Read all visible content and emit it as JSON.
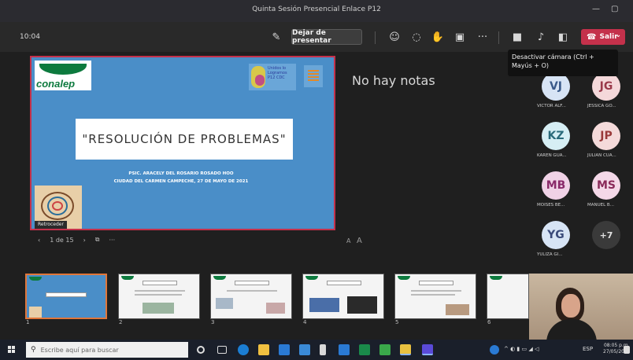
{
  "window": {
    "title": "Quinta Sesión Presencial Enlace P12",
    "minimize": "—",
    "maximize": "▢"
  },
  "meeting": {
    "timer": "10:04",
    "stop_presenting": "Dejar de presentar",
    "leave": "Salir",
    "tooltip": "Desactivar cámara (Ctrl + Mayús + O)"
  },
  "slide": {
    "logo_text": "conalep",
    "partner_logo_text": "Unidos lo Logramos P12 CDC",
    "title": "\"RESOLUCIÓN DE PROBLEMAS\"",
    "author_line1": "PSIC. ARACELY DEL ROSARIO ROSADO HOO",
    "author_line2": "CIUDAD DEL CARMEN CAMPECHE, 27 DE MAYO DE 2021",
    "presenting_tag": "Retroceder"
  },
  "slide_nav": {
    "page": "1 de 15",
    "next": "›",
    "prev": "‹",
    "more": "···",
    "font_small": "A",
    "font_large": "A"
  },
  "notes": {
    "text": "No hay notas"
  },
  "participants": [
    {
      "initials": "VJ",
      "name": "VICTOR ALF...",
      "bg": "#d7e4f5",
      "fg": "#3a5a8a"
    },
    {
      "initials": "JG",
      "name": "JESSICA GO...",
      "bg": "#f4d8da",
      "fg": "#9a3a4a"
    },
    {
      "initials": "KZ",
      "name": "KAREN GUA...",
      "bg": "#d6eef4",
      "fg": "#2a6a7a"
    },
    {
      "initials": "JP",
      "name": "JULIAN CUA...",
      "bg": "#f4dada",
      "fg": "#9a3a3a"
    },
    {
      "initials": "MB",
      "name": "MOISES BE...",
      "bg": "#f0d2e6",
      "fg": "#8a2a6a"
    },
    {
      "initials": "MS",
      "name": "MANUEL B...",
      "bg": "#f4d8e8",
      "fg": "#8a2a5a"
    },
    {
      "initials": "YG",
      "name": "YULIZA GI...",
      "bg": "#d7e4f5",
      "fg": "#3a4a7a"
    },
    {
      "initials": "+7",
      "name": "",
      "bg": "#3a3a3a",
      "fg": "#e0e0e0"
    }
  ],
  "thumbnails": [
    "1",
    "2",
    "3",
    "4",
    "5",
    "6"
  ],
  "taskbar": {
    "search_placeholder": "Escribe aquí para buscar",
    "lang": "ESP",
    "time": "08:05 p.m.",
    "date": "27/05/2021"
  },
  "icons": {
    "mic": "microphone-icon",
    "camera": "camera-icon"
  }
}
